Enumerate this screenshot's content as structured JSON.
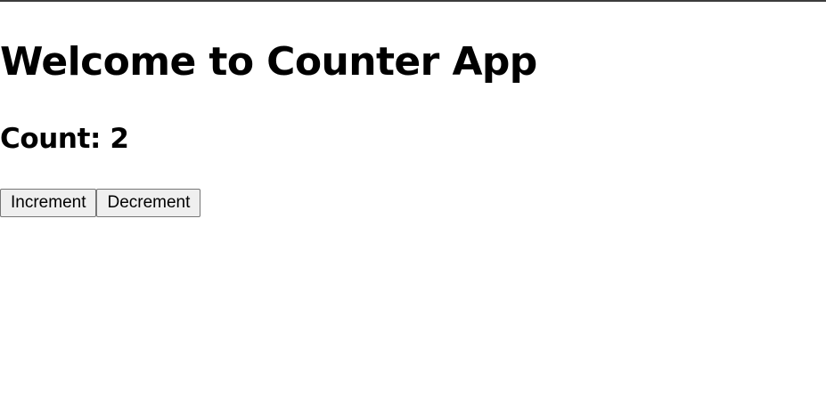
{
  "page": {
    "title": "Welcome to Counter App"
  },
  "counter": {
    "label": "Count:",
    "value": 2
  },
  "buttons": {
    "increment_label": "Increment",
    "decrement_label": "Decrement"
  }
}
